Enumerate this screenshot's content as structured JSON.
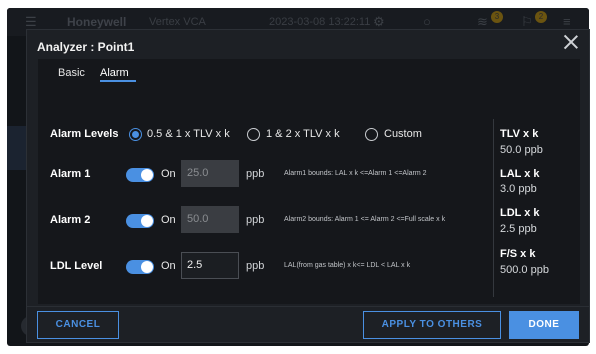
{
  "background_app": {
    "brand": "Honeywell",
    "subtitle": "Vertex VCA",
    "datetime": "2023-03-08 13:22:11",
    "badge_a": "3",
    "badge_b": "2"
  },
  "dialog": {
    "title": "Analyzer : Point1",
    "tabs": [
      {
        "label": "Basic",
        "active": false
      },
      {
        "label": "Alarm",
        "active": true
      }
    ],
    "alarm_levels": {
      "label": "Alarm Levels",
      "options": [
        {
          "label": "0.5 & 1 x TLV x k",
          "checked": true
        },
        {
          "label": "1 & 2 x TLV x k",
          "checked": false
        },
        {
          "label": "Custom",
          "checked": false
        }
      ]
    },
    "rows": [
      {
        "label": "Alarm 1",
        "toggle_text": "On",
        "on": true,
        "value": "25.0",
        "editable": false,
        "unit": "ppb",
        "bounds": "Alarm1 bounds: LAL x k <=Alarm 1 <=Alarm 2"
      },
      {
        "label": "Alarm 2",
        "toggle_text": "On",
        "on": true,
        "value": "50.0",
        "editable": false,
        "unit": "ppb",
        "bounds": "Alarm2 bounds: Alarm 1 <= Alarm 2 <=Full scale x k"
      },
      {
        "label": "LDL Level",
        "toggle_text": "On",
        "on": true,
        "value": "2.5",
        "editable": true,
        "unit": "ppb",
        "bounds": "LAL(from gas table) x k<= LDL < LAL x k"
      }
    ],
    "info": [
      {
        "label": "TLV x k",
        "value": "50.0 ppb"
      },
      {
        "label": "LAL x k",
        "value": "3.0 ppb"
      },
      {
        "label": "LDL x k",
        "value": "2.5 ppb"
      },
      {
        "label": "F/S x k",
        "value": "500.0 ppb"
      }
    ],
    "buttons": {
      "cancel": "CANCEL",
      "apply": "APPLY TO OTHERS",
      "done": "DONE"
    }
  },
  "colors": {
    "accent": "#4a90e2",
    "dialog_bg": "#1d2025",
    "panel_bg": "#15171b"
  }
}
